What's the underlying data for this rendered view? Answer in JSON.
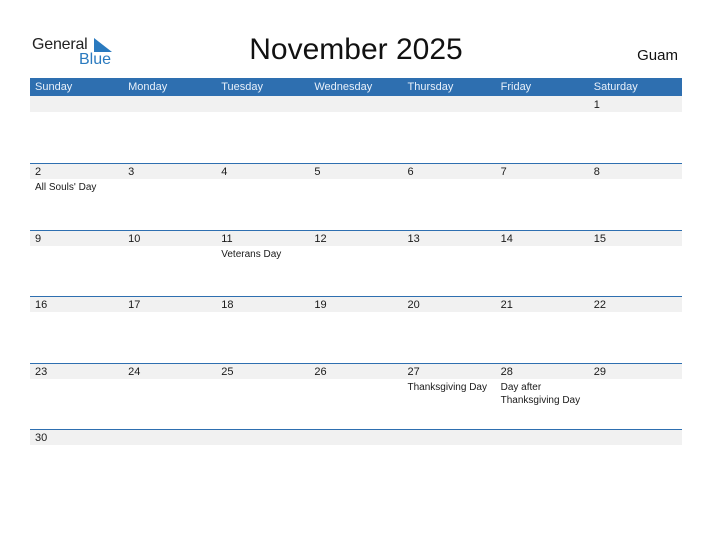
{
  "logo": {
    "line1": "General",
    "line2": "Blue"
  },
  "title": "November 2025",
  "country": "Guam",
  "colors": {
    "accent": "#2e6fb0",
    "band": "#f1f1f1"
  },
  "weekdays": [
    "Sunday",
    "Monday",
    "Tuesday",
    "Wednesday",
    "Thursday",
    "Friday",
    "Saturday"
  ],
  "weeks": [
    [
      {
        "day": "",
        "holiday": ""
      },
      {
        "day": "",
        "holiday": ""
      },
      {
        "day": "",
        "holiday": ""
      },
      {
        "day": "",
        "holiday": ""
      },
      {
        "day": "",
        "holiday": ""
      },
      {
        "day": "",
        "holiday": ""
      },
      {
        "day": "1",
        "holiday": ""
      }
    ],
    [
      {
        "day": "2",
        "holiday": "All Souls' Day"
      },
      {
        "day": "3",
        "holiday": ""
      },
      {
        "day": "4",
        "holiday": ""
      },
      {
        "day": "5",
        "holiday": ""
      },
      {
        "day": "6",
        "holiday": ""
      },
      {
        "day": "7",
        "holiday": ""
      },
      {
        "day": "8",
        "holiday": ""
      }
    ],
    [
      {
        "day": "9",
        "holiday": ""
      },
      {
        "day": "10",
        "holiday": ""
      },
      {
        "day": "11",
        "holiday": "Veterans Day"
      },
      {
        "day": "12",
        "holiday": ""
      },
      {
        "day": "13",
        "holiday": ""
      },
      {
        "day": "14",
        "holiday": ""
      },
      {
        "day": "15",
        "holiday": ""
      }
    ],
    [
      {
        "day": "16",
        "holiday": ""
      },
      {
        "day": "17",
        "holiday": ""
      },
      {
        "day": "18",
        "holiday": ""
      },
      {
        "day": "19",
        "holiday": ""
      },
      {
        "day": "20",
        "holiday": ""
      },
      {
        "day": "21",
        "holiday": ""
      },
      {
        "day": "22",
        "holiday": ""
      }
    ],
    [
      {
        "day": "23",
        "holiday": ""
      },
      {
        "day": "24",
        "holiday": ""
      },
      {
        "day": "25",
        "holiday": ""
      },
      {
        "day": "26",
        "holiday": ""
      },
      {
        "day": "27",
        "holiday": "Thanksgiving Day"
      },
      {
        "day": "28",
        "holiday": "Day after Thanksgiving Day"
      },
      {
        "day": "29",
        "holiday": ""
      }
    ],
    [
      {
        "day": "30",
        "holiday": ""
      },
      {
        "day": "",
        "holiday": ""
      },
      {
        "day": "",
        "holiday": ""
      },
      {
        "day": "",
        "holiday": ""
      },
      {
        "day": "",
        "holiday": ""
      },
      {
        "day": "",
        "holiday": ""
      },
      {
        "day": "",
        "holiday": ""
      }
    ]
  ]
}
